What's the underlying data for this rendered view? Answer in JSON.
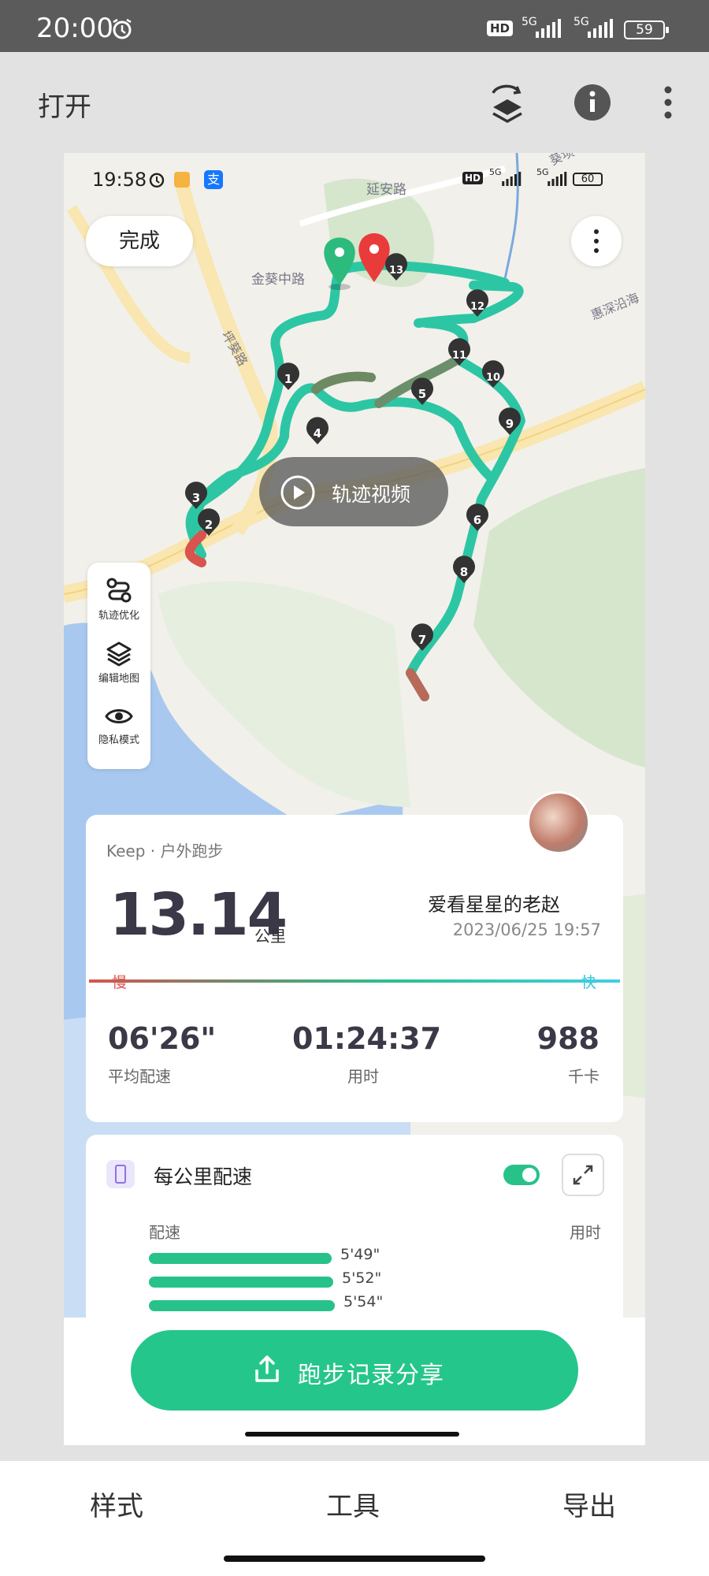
{
  "status_bar": {
    "time": "20:00",
    "battery": "59",
    "network": "5G"
  },
  "app_bar": {
    "open_label": "打开"
  },
  "screenshot": {
    "status": {
      "time": "19:58",
      "battery": "60",
      "network": "5G"
    },
    "map": {
      "road_labels": [
        "延安路",
        "金葵中路",
        "坪葵路",
        "惠深沿海",
        "葵坝"
      ],
      "km_markers": [
        "1",
        "2",
        "3",
        "4",
        "5",
        "6",
        "7",
        "8",
        "9",
        "10",
        "11",
        "12",
        "13"
      ]
    },
    "done_label": "完成",
    "video_label": "轨迹视频",
    "tools": [
      {
        "label": "轨迹优化",
        "icon": "route-icon"
      },
      {
        "label": "编辑地图",
        "icon": "layers-icon"
      },
      {
        "label": "隐私模式",
        "icon": "eye-icon"
      }
    ],
    "summary": {
      "source": "Keep · 户外跑步",
      "distance": "13.14",
      "distance_unit": "公里",
      "user_name": "爱看星星的老赵",
      "datetime": "2023/06/25 19:57",
      "slow_label": "慢",
      "fast_label": "快",
      "stats": [
        {
          "value": "06'26\"",
          "label": "平均配速"
        },
        {
          "value": "01:24:37",
          "label": "用时"
        },
        {
          "value": "988",
          "label": "千卡"
        }
      ]
    },
    "splits": {
      "title": "每公里配速",
      "col_pace": "配速",
      "col_time": "用时",
      "rows": [
        "5'49\"",
        "5'52\"",
        "5'54\""
      ],
      "toggle_on": true
    },
    "share_label": "跑步记录分享"
  },
  "bottom_tabs": [
    "样式",
    "工具",
    "导出"
  ],
  "colors": {
    "accent": "#25c68b",
    "route": "#2dc6a4"
  }
}
